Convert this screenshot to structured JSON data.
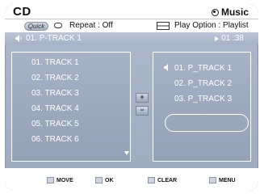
{
  "header": {
    "title": "CD",
    "mode": "Music",
    "mode_icon": "music-icon"
  },
  "status": {
    "quick_label": "Quick",
    "repeat_label": "Repeat : Off",
    "play_option_label": "Play Option : Playlist"
  },
  "now_playing": {
    "track": "01. P-TRACK 1",
    "time": "01 :38"
  },
  "track_list": {
    "items": [
      "01. TRACK 1",
      "02. TRACK 2",
      "03. TRACK 3",
      "04. TRACK 4",
      "05. TRACK 5",
      "06. TRACK 6"
    ]
  },
  "transfer": {
    "add_label": "+",
    "remove_label": "−"
  },
  "playlist": {
    "items": [
      "01. P_TRACK 1",
      "02. P_TRACK 2",
      "03. P_TRACK 3"
    ]
  },
  "footer": {
    "move_label": "MOVE",
    "ok_label": "OK",
    "clear_label": "CLEAR",
    "menu_label": "MENU"
  },
  "colors": {
    "panel": "#9eabbe",
    "text": "#ffffff",
    "header_bg": "#ffffff"
  }
}
